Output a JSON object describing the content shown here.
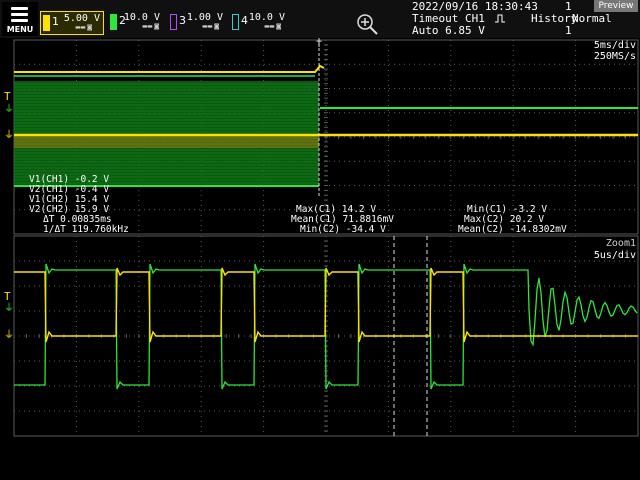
{
  "menu": {
    "label": "MENU"
  },
  "channels": [
    {
      "num": "1",
      "value": "5.00 V",
      "color": "#ffe100"
    },
    {
      "num": "2",
      "value": "10.0 V",
      "color": "#2ee63c"
    },
    {
      "num": "3",
      "value": "1.00 V",
      "color": "#b84aff"
    },
    {
      "num": "4",
      "value": "10.0 V",
      "color": "#2ed1c8"
    }
  ],
  "header": {
    "datetime": "2022/09/16 18:30:43",
    "counter": "1",
    "trigger_label": "Timeout CH1",
    "trigger_level": "Auto 6.85 V",
    "history_label": "History",
    "history_count": "1",
    "mode": "Normal",
    "preview": "Preview",
    "timebase": "5ms/div",
    "sample_rate": "250MS/s"
  },
  "cursor_readouts": {
    "v1_ch1": "V1(CH1) -0.2 V",
    "v2_ch1": "V2(CH1) -0.4 V",
    "v1_ch2": "V1(CH2) 15.4 V",
    "v2_ch2": "V2(CH2) 15.9 V",
    "delta_t": "ΔT  0.00835ms",
    "inv_delta_t": "1/ΔT  119.760kHz"
  },
  "measurements": {
    "max_c1": "Max(C1)  14.2 V",
    "mean_c1": "Mean(C1)  71.8816mV",
    "min_c2": "Min(C2)  -34.4 V",
    "min_c1": "Min(C1)  -3.2 V",
    "max_c2": "Max(C2)  20.2 V",
    "mean_c2": "Mean(C2)  -14.8302mV"
  },
  "zoom": {
    "label": "Zoom1",
    "timebase": "5us/div"
  },
  "colors": {
    "ch1": "#ffe100",
    "ch2": "#2ee63c",
    "grid": "#5a5a5a",
    "bg": "#000000"
  },
  "chart_data": {
    "type": "line",
    "series": [
      {
        "name": "CH1",
        "values": [
          -0.2,
          14.2,
          -3.2
        ]
      },
      {
        "name": "CH2",
        "values": [
          15.4,
          20.2,
          -34.4
        ]
      }
    ]
  }
}
